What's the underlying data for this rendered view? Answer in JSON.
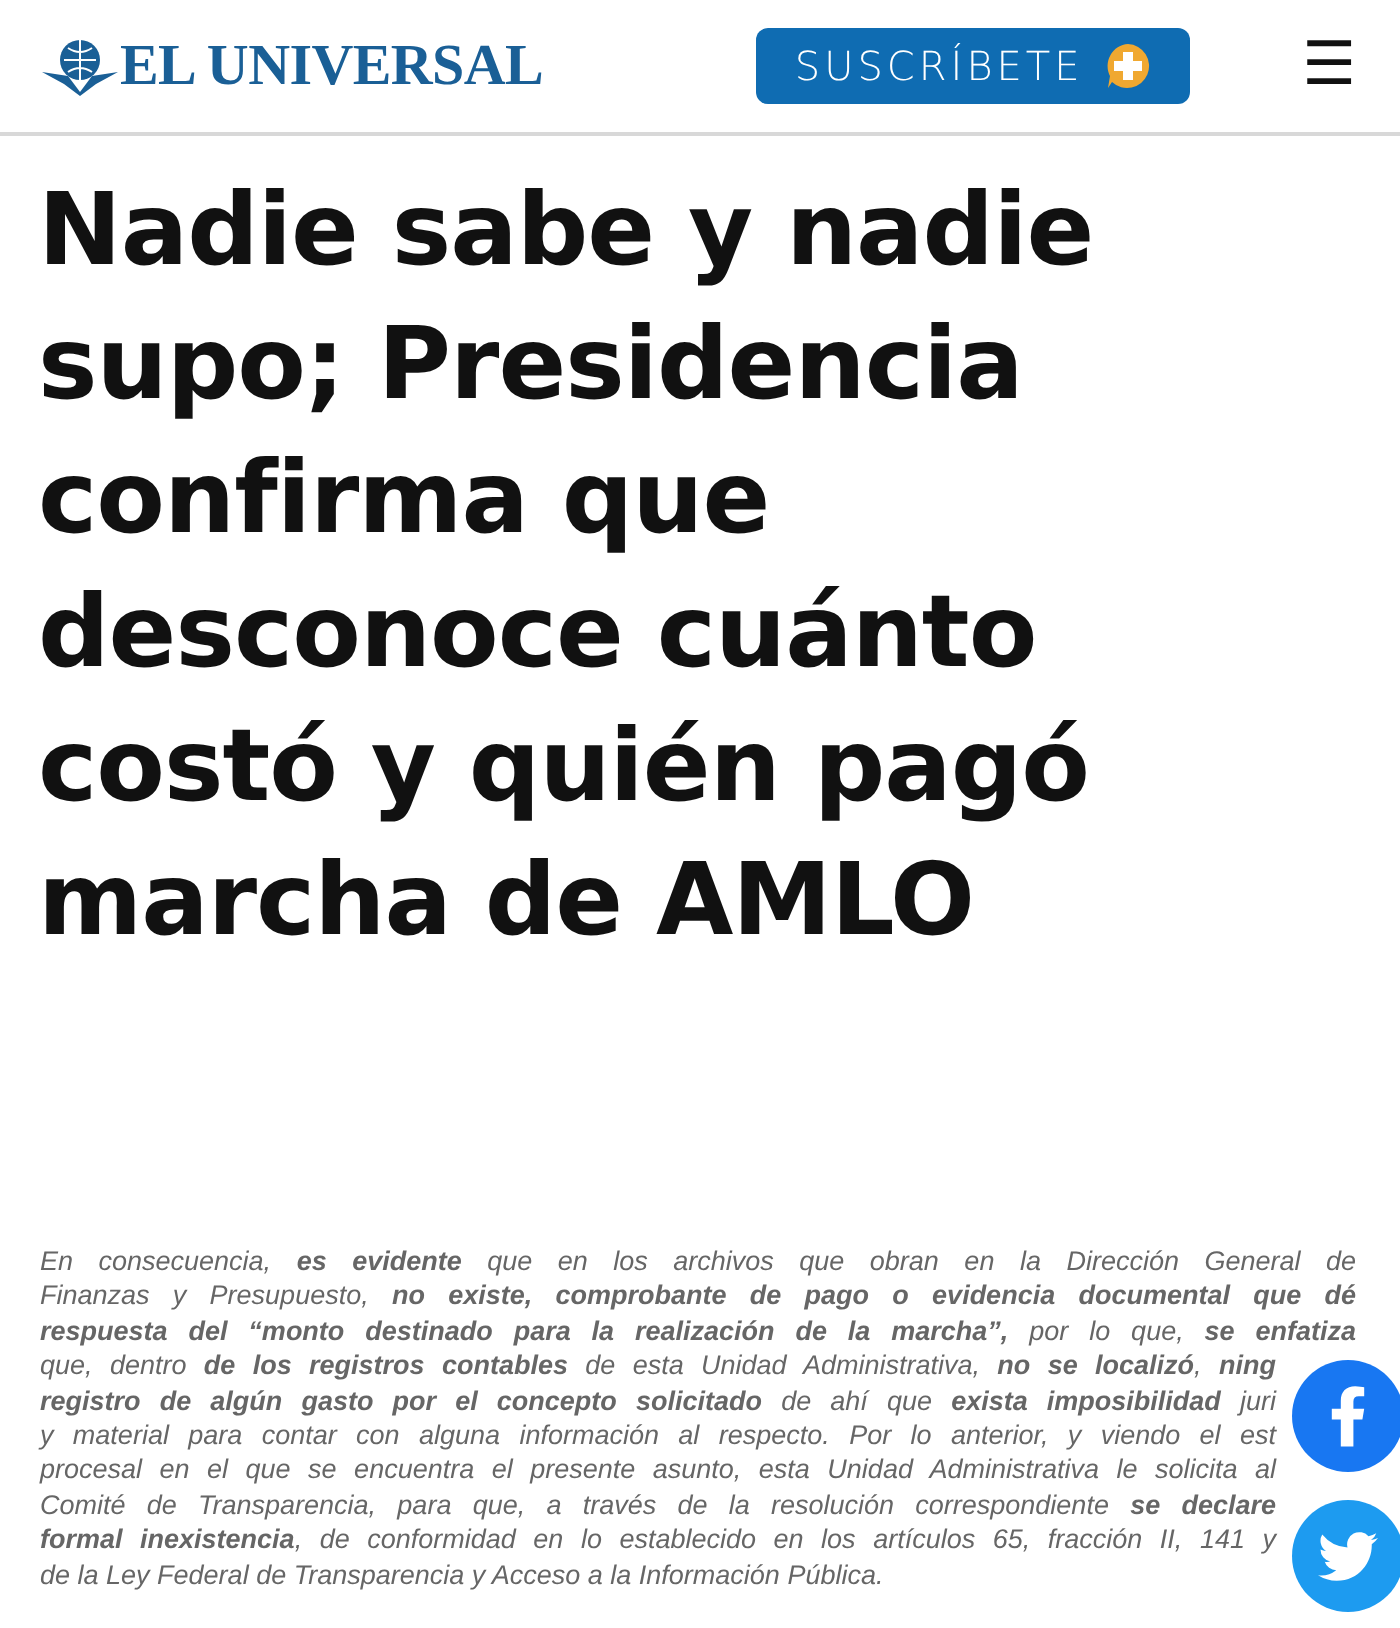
{
  "header": {
    "logo": "EL UNIVERSAL",
    "subscribe_button": "SUSCRÍBETE",
    "menu_button": "☰"
  },
  "headline": "Nadie sabe y nadie supo; Presidencia confirma que desconoce cuánto costó y quién pagó marcha de AMLO",
  "document_lines": [
    "En consecuencia, **es evidente** que en los archivos que obran en la Dirección General de",
    "Finanzas y Presupuesto, **no existe, comprobante de pago o evidencia documental que dé**",
    "**respuesta del “monto destinado para la realización de la marcha”,** por lo que, **se enfatiza**",
    "que, dentro **de los registros contables** de esta Unidad Administrativa, **no se localizó**, **ning**",
    "**registro de algún gasto por el concepto solicitado** de ahí que **exista imposibilidad** juri",
    "y material para contar con alguna información al respecto. Por lo anterior, y viendo el est",
    "procesal en el que se encuentra el presente asunto, esta Unidad Administrativa le solicita al",
    "Comité de Transparencia, para que, a través de la resolución correspondiente **se declare**",
    "**formal inexistencia**, de conformidad en lo establecido en los artículos 65, fracción II, 141 y",
    "de la Ley Federal de Transparencia y Acceso a la Información Pública."
  ],
  "share_buttons": [
    {
      "kind": "facebook"
    },
    {
      "kind": "twitter"
    }
  ]
}
